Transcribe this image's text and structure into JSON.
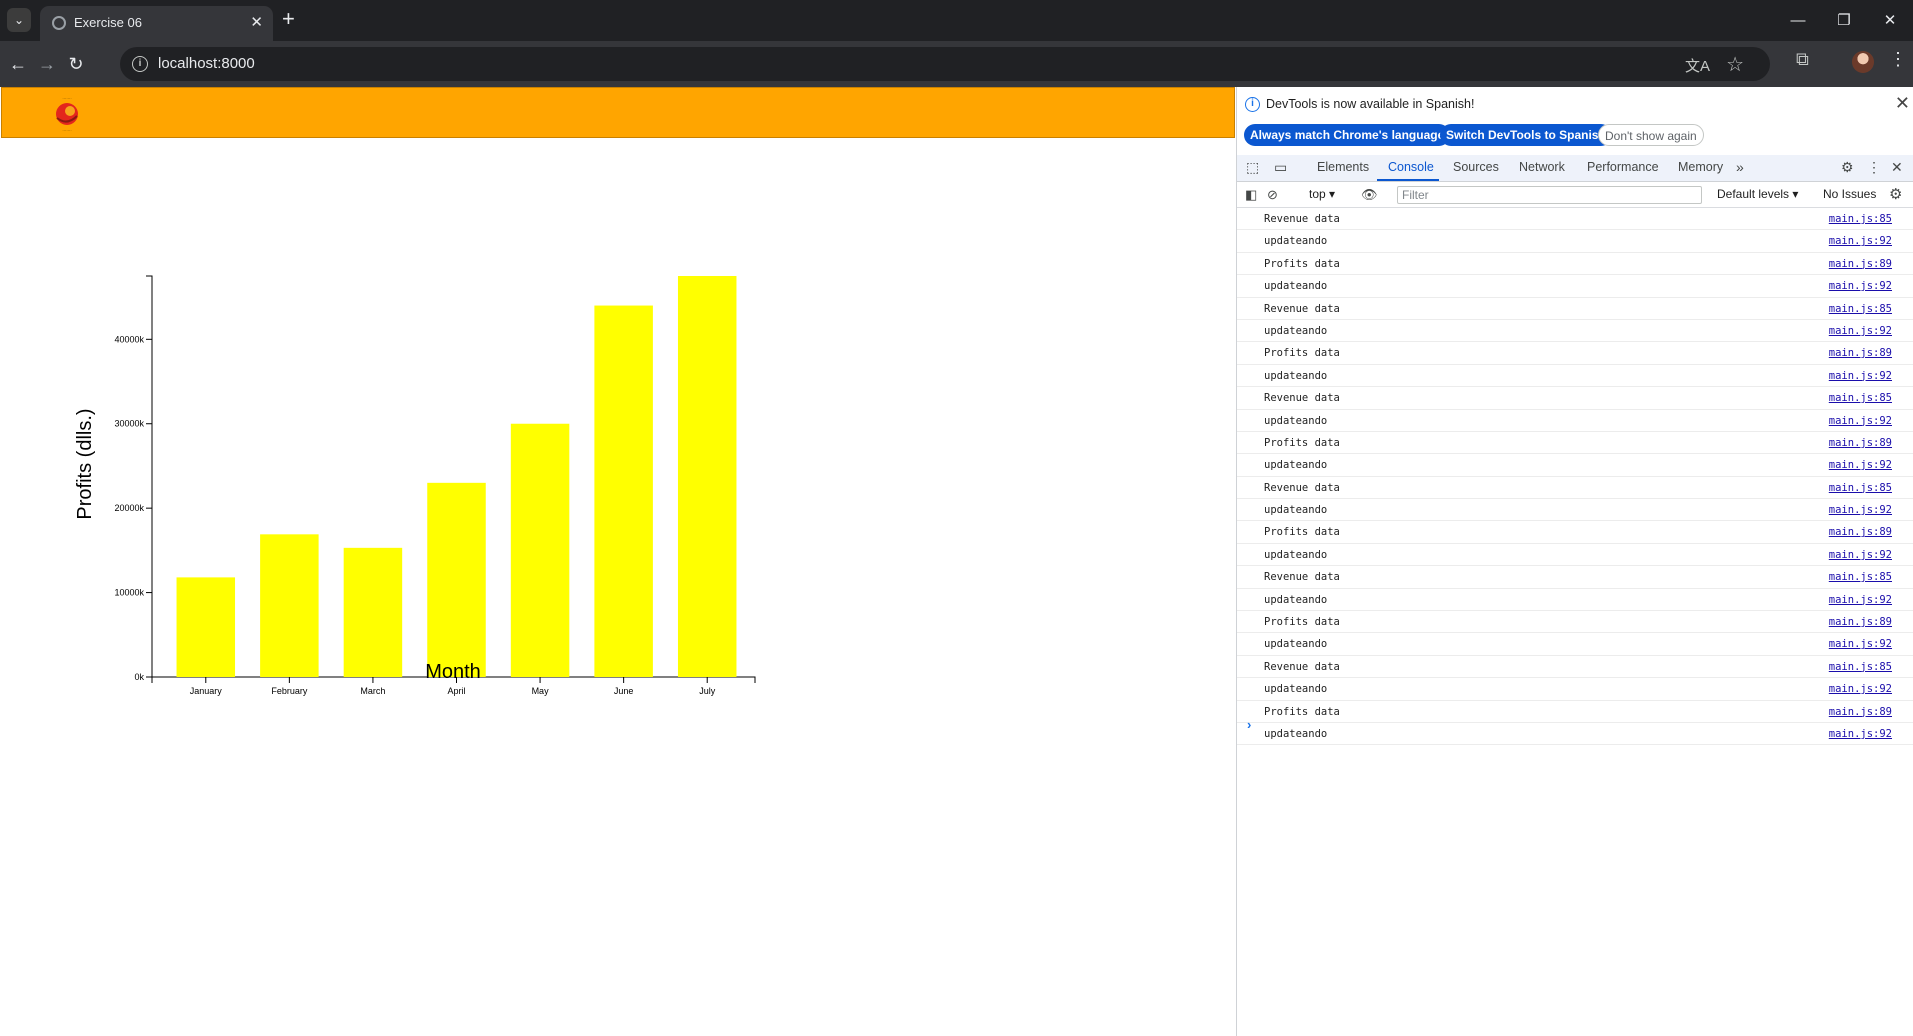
{
  "browser": {
    "tab_title": "Exercise 06",
    "url": "localhost:8000"
  },
  "chart_data": {
    "type": "bar",
    "categories": [
      "January",
      "February",
      "March",
      "April",
      "May",
      "June",
      "July"
    ],
    "values": [
      11800,
      16900,
      15300,
      23000,
      30000,
      44000,
      47500
    ],
    "ylabel": "Profits (dlls.)",
    "xlabel": "Month",
    "yticks": [
      "0k",
      "10000k",
      "20000k",
      "30000k",
      "40000k"
    ],
    "ylim": [
      0,
      47500
    ],
    "bar_color": "#ffff00",
    "grid": false
  },
  "page": {
    "header_color": "#ffa500"
  },
  "devtools": {
    "infobar_message": "DevTools is now available in Spanish!",
    "btn_match": "Always match Chrome's language",
    "btn_switch": "Switch DevTools to Spanish",
    "btn_dontshow": "Don't show again",
    "tabs": [
      "Elements",
      "Console",
      "Sources",
      "Network",
      "Performance",
      "Memory"
    ],
    "context": "top",
    "filter_placeholder": "Filter",
    "levels": "Default levels",
    "issues": "No Issues",
    "logs": [
      {
        "msg": "Revenue data",
        "src": "main.js:85"
      },
      {
        "msg": "updateando",
        "src": "main.js:92"
      },
      {
        "msg": "Profits data",
        "src": "main.js:89"
      },
      {
        "msg": "updateando",
        "src": "main.js:92"
      },
      {
        "msg": "Revenue data",
        "src": "main.js:85"
      },
      {
        "msg": "updateando",
        "src": "main.js:92"
      },
      {
        "msg": "Profits data",
        "src": "main.js:89"
      },
      {
        "msg": "updateando",
        "src": "main.js:92"
      },
      {
        "msg": "Revenue data",
        "src": "main.js:85"
      },
      {
        "msg": "updateando",
        "src": "main.js:92"
      },
      {
        "msg": "Profits data",
        "src": "main.js:89"
      },
      {
        "msg": "updateando",
        "src": "main.js:92"
      },
      {
        "msg": "Revenue data",
        "src": "main.js:85"
      },
      {
        "msg": "updateando",
        "src": "main.js:92"
      },
      {
        "msg": "Profits data",
        "src": "main.js:89"
      },
      {
        "msg": "updateando",
        "src": "main.js:92"
      },
      {
        "msg": "Revenue data",
        "src": "main.js:85"
      },
      {
        "msg": "updateando",
        "src": "main.js:92"
      },
      {
        "msg": "Profits data",
        "src": "main.js:89"
      },
      {
        "msg": "updateando",
        "src": "main.js:92"
      },
      {
        "msg": "Revenue data",
        "src": "main.js:85"
      },
      {
        "msg": "updateando",
        "src": "main.js:92"
      },
      {
        "msg": "Profits data",
        "src": "main.js:89"
      },
      {
        "msg": "updateando",
        "src": "main.js:92"
      }
    ]
  }
}
